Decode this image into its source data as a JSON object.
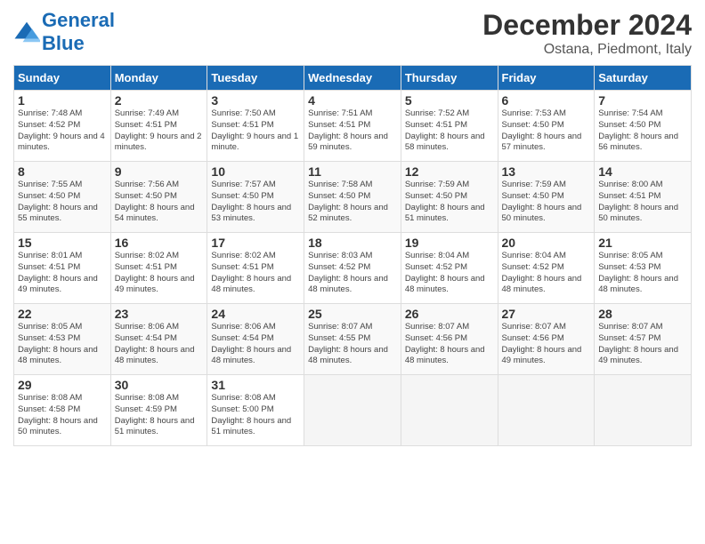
{
  "header": {
    "logo_general": "General",
    "logo_blue": "Blue",
    "month": "December 2024",
    "location": "Ostana, Piedmont, Italy"
  },
  "days_of_week": [
    "Sunday",
    "Monday",
    "Tuesday",
    "Wednesday",
    "Thursday",
    "Friday",
    "Saturday"
  ],
  "weeks": [
    [
      {
        "num": "1",
        "rise": "7:48 AM",
        "set": "4:52 PM",
        "daylight": "9 hours and 4 minutes."
      },
      {
        "num": "2",
        "rise": "7:49 AM",
        "set": "4:51 PM",
        "daylight": "9 hours and 2 minutes."
      },
      {
        "num": "3",
        "rise": "7:50 AM",
        "set": "4:51 PM",
        "daylight": "9 hours and 1 minute."
      },
      {
        "num": "4",
        "rise": "7:51 AM",
        "set": "4:51 PM",
        "daylight": "8 hours and 59 minutes."
      },
      {
        "num": "5",
        "rise": "7:52 AM",
        "set": "4:51 PM",
        "daylight": "8 hours and 58 minutes."
      },
      {
        "num": "6",
        "rise": "7:53 AM",
        "set": "4:50 PM",
        "daylight": "8 hours and 57 minutes."
      },
      {
        "num": "7",
        "rise": "7:54 AM",
        "set": "4:50 PM",
        "daylight": "8 hours and 56 minutes."
      }
    ],
    [
      {
        "num": "8",
        "rise": "7:55 AM",
        "set": "4:50 PM",
        "daylight": "8 hours and 55 minutes."
      },
      {
        "num": "9",
        "rise": "7:56 AM",
        "set": "4:50 PM",
        "daylight": "8 hours and 54 minutes."
      },
      {
        "num": "10",
        "rise": "7:57 AM",
        "set": "4:50 PM",
        "daylight": "8 hours and 53 minutes."
      },
      {
        "num": "11",
        "rise": "7:58 AM",
        "set": "4:50 PM",
        "daylight": "8 hours and 52 minutes."
      },
      {
        "num": "12",
        "rise": "7:59 AM",
        "set": "4:50 PM",
        "daylight": "8 hours and 51 minutes."
      },
      {
        "num": "13",
        "rise": "7:59 AM",
        "set": "4:50 PM",
        "daylight": "8 hours and 50 minutes."
      },
      {
        "num": "14",
        "rise": "8:00 AM",
        "set": "4:51 PM",
        "daylight": "8 hours and 50 minutes."
      }
    ],
    [
      {
        "num": "15",
        "rise": "8:01 AM",
        "set": "4:51 PM",
        "daylight": "8 hours and 49 minutes."
      },
      {
        "num": "16",
        "rise": "8:02 AM",
        "set": "4:51 PM",
        "daylight": "8 hours and 49 minutes."
      },
      {
        "num": "17",
        "rise": "8:02 AM",
        "set": "4:51 PM",
        "daylight": "8 hours and 48 minutes."
      },
      {
        "num": "18",
        "rise": "8:03 AM",
        "set": "4:52 PM",
        "daylight": "8 hours and 48 minutes."
      },
      {
        "num": "19",
        "rise": "8:04 AM",
        "set": "4:52 PM",
        "daylight": "8 hours and 48 minutes."
      },
      {
        "num": "20",
        "rise": "8:04 AM",
        "set": "4:52 PM",
        "daylight": "8 hours and 48 minutes."
      },
      {
        "num": "21",
        "rise": "8:05 AM",
        "set": "4:53 PM",
        "daylight": "8 hours and 48 minutes."
      }
    ],
    [
      {
        "num": "22",
        "rise": "8:05 AM",
        "set": "4:53 PM",
        "daylight": "8 hours and 48 minutes."
      },
      {
        "num": "23",
        "rise": "8:06 AM",
        "set": "4:54 PM",
        "daylight": "8 hours and 48 minutes."
      },
      {
        "num": "24",
        "rise": "8:06 AM",
        "set": "4:54 PM",
        "daylight": "8 hours and 48 minutes."
      },
      {
        "num": "25",
        "rise": "8:07 AM",
        "set": "4:55 PM",
        "daylight": "8 hours and 48 minutes."
      },
      {
        "num": "26",
        "rise": "8:07 AM",
        "set": "4:56 PM",
        "daylight": "8 hours and 48 minutes."
      },
      {
        "num": "27",
        "rise": "8:07 AM",
        "set": "4:56 PM",
        "daylight": "8 hours and 49 minutes."
      },
      {
        "num": "28",
        "rise": "8:07 AM",
        "set": "4:57 PM",
        "daylight": "8 hours and 49 minutes."
      }
    ],
    [
      {
        "num": "29",
        "rise": "8:08 AM",
        "set": "4:58 PM",
        "daylight": "8 hours and 50 minutes."
      },
      {
        "num": "30",
        "rise": "8:08 AM",
        "set": "4:59 PM",
        "daylight": "8 hours and 51 minutes."
      },
      {
        "num": "31",
        "rise": "8:08 AM",
        "set": "5:00 PM",
        "daylight": "8 hours and 51 minutes."
      },
      null,
      null,
      null,
      null
    ]
  ]
}
